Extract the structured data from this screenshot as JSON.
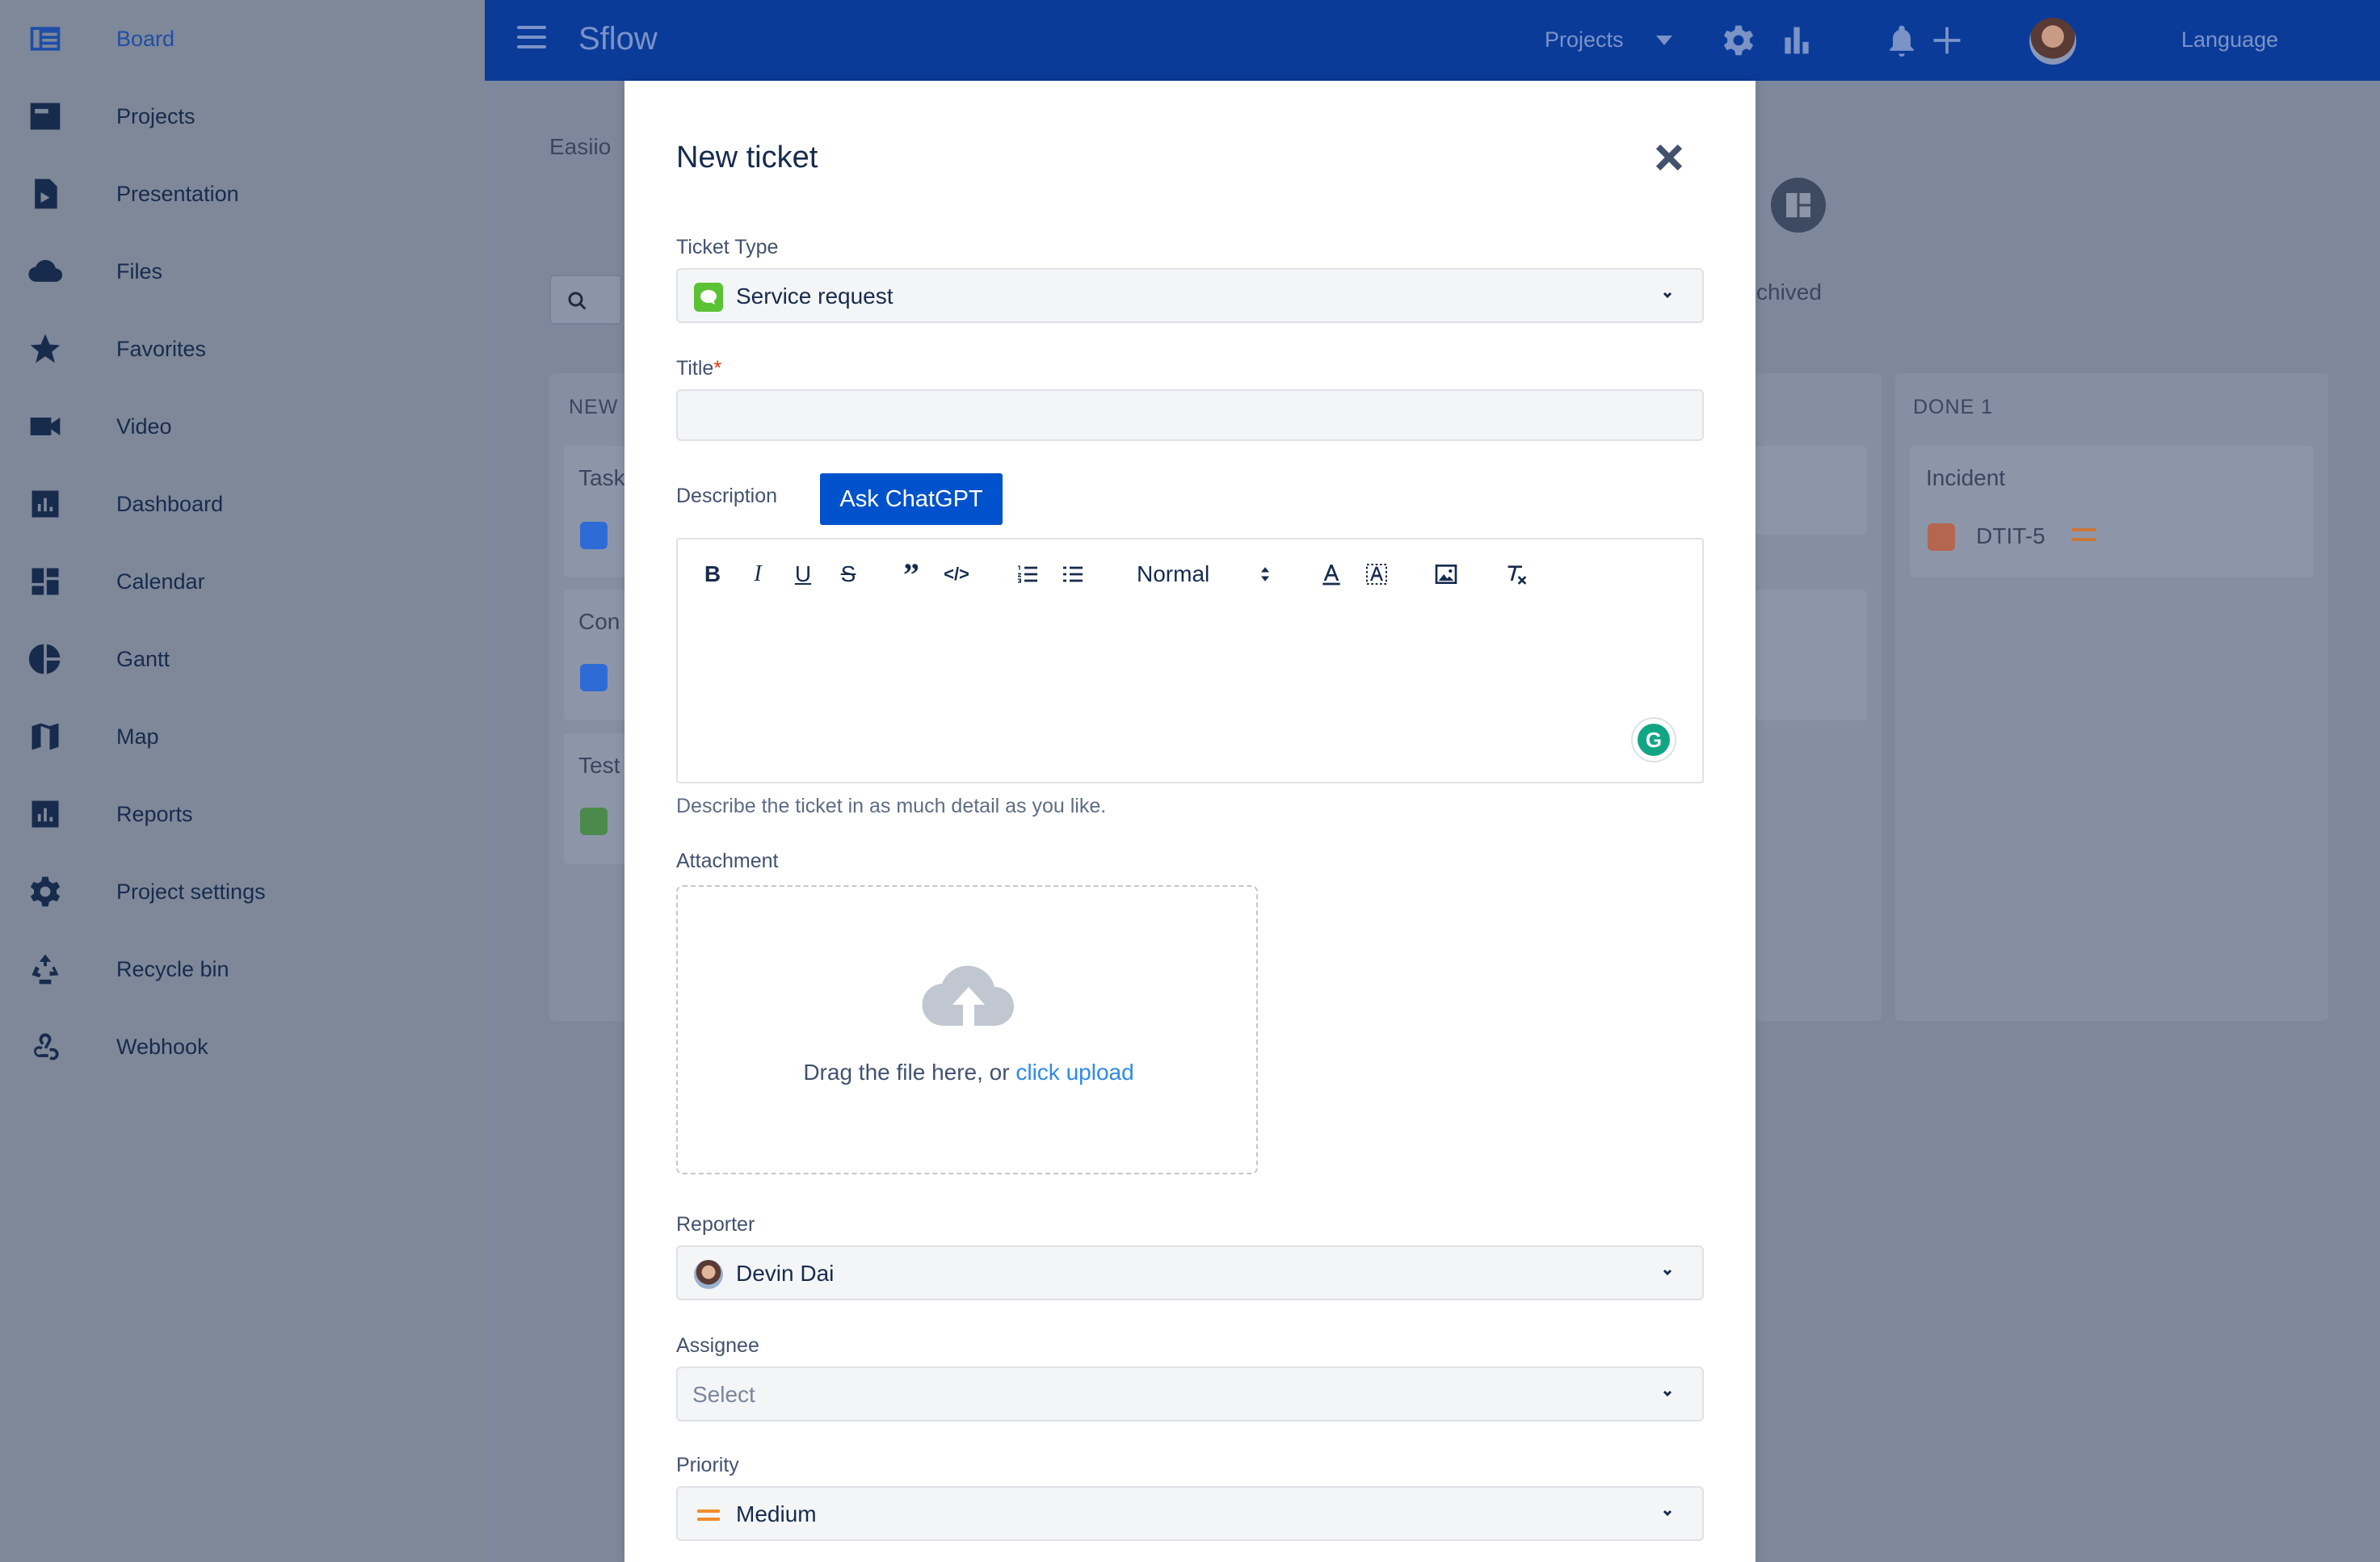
{
  "sidebar": {
    "items": [
      {
        "label": "Board",
        "icon": "board-icon"
      },
      {
        "label": "Projects",
        "icon": "projects-icon"
      },
      {
        "label": "Presentation",
        "icon": "presentation-icon"
      },
      {
        "label": "Files",
        "icon": "cloud-icon"
      },
      {
        "label": "Favorites",
        "icon": "star-icon"
      },
      {
        "label": "Video",
        "icon": "video-icon"
      },
      {
        "label": "Dashboard",
        "icon": "dashboard-icon"
      },
      {
        "label": "Calendar",
        "icon": "calendar-icon"
      },
      {
        "label": "Gantt",
        "icon": "gantt-icon"
      },
      {
        "label": "Map",
        "icon": "map-icon"
      },
      {
        "label": "Reports",
        "icon": "reports-icon"
      },
      {
        "label": "Project settings",
        "icon": "gear-icon"
      },
      {
        "label": "Recycle bin",
        "icon": "recycle-icon"
      },
      {
        "label": "Webhook",
        "icon": "webhook-icon"
      }
    ]
  },
  "topbar": {
    "app_name": "Sflow",
    "projects_label": "Projects",
    "language_label": "Language"
  },
  "background": {
    "breadcrumb": "Easiio",
    "archived_fragment": "chived",
    "col_new_title": "NEW",
    "col_done_title": "DONE 1",
    "card_task": "Task",
    "card_con": "Con",
    "card_test": "Test",
    "card_incident": "Incident",
    "card_incident_key": "DTIT-5"
  },
  "modal": {
    "title": "New ticket",
    "ticket_type": {
      "label": "Ticket Type",
      "value": "Service request"
    },
    "title_field": {
      "label": "Title",
      "required_mark": "*",
      "value": ""
    },
    "description": {
      "label": "Description",
      "ask_button": "Ask ChatGPT",
      "help": "Describe the ticket in as much detail as you like."
    },
    "editor_toolbar": {
      "heading_select": "Normal"
    },
    "attachment": {
      "label": "Attachment",
      "drag_text": "Drag the file here, or",
      "upload_link": "click upload"
    },
    "reporter": {
      "label": "Reporter",
      "value": "Devin Dai"
    },
    "assignee": {
      "label": "Assignee",
      "placeholder": "Select"
    },
    "priority": {
      "label": "Priority",
      "value": "Medium"
    }
  },
  "colors": {
    "topbar": "#0a3b99",
    "primary_button": "#0052cc",
    "link": "#2e8ae6",
    "service_request_badge": "#5bc236",
    "priority_medium": "#f08c2a"
  }
}
